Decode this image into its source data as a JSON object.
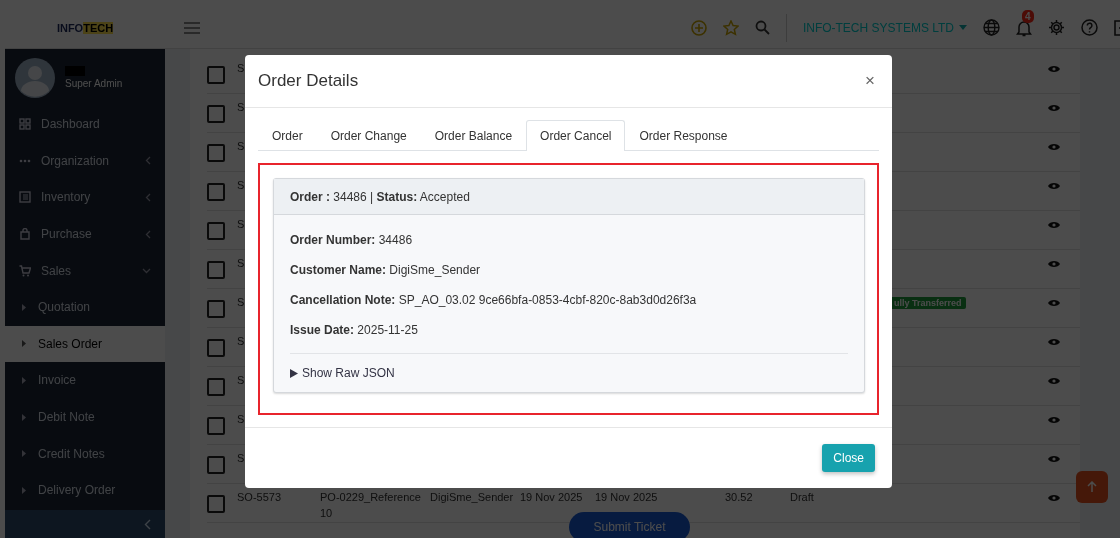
{
  "topbar": {
    "logo": {
      "part_1": "INFO",
      "part_2": "TECH"
    },
    "company": "INFO-TECH SYSTEMS LTD",
    "notification_count": "4"
  },
  "sidebar": {
    "user_role": "Super Admin",
    "items": [
      {
        "label": "Dashboard",
        "kind": "link",
        "selected": false
      },
      {
        "label": "Organization",
        "kind": "group",
        "expanded": false,
        "selected": false
      },
      {
        "label": "Inventory",
        "kind": "group",
        "expanded": false,
        "selected": false
      },
      {
        "label": "Purchase",
        "kind": "group",
        "expanded": false,
        "selected": false
      },
      {
        "label": "Sales",
        "kind": "group",
        "expanded": true,
        "selected": false,
        "children": [
          {
            "label": "Quotation",
            "selected": false
          },
          {
            "label": "Sales Order",
            "selected": true
          },
          {
            "label": "Invoice",
            "selected": false
          },
          {
            "label": "Debit Note",
            "selected": false
          },
          {
            "label": "Credit Notes",
            "selected": false
          },
          {
            "label": "Delivery Order",
            "selected": false
          }
        ]
      }
    ]
  },
  "table": {
    "rows": [
      {
        "checked": false,
        "column_1": "S"
      },
      {
        "checked": false,
        "column_1": "S"
      },
      {
        "checked": false,
        "column_1": "S"
      },
      {
        "checked": false,
        "column_1": "S"
      },
      {
        "checked": false,
        "column_1": "S"
      },
      {
        "checked": false,
        "column_1": "S"
      },
      {
        "checked": false,
        "column_1": "S",
        "badge": "ully Transferred"
      },
      {
        "checked": false,
        "column_1": "S"
      },
      {
        "checked": false,
        "column_1": "S"
      },
      {
        "checked": false,
        "column_1": "S"
      },
      {
        "checked": false,
        "column_1": "S"
      },
      {
        "checked": false,
        "column_1": "SO-5573",
        "column_2": "PO-0229_Reference 10",
        "column_3": "DigiSme_Sender",
        "column_4": "19 Nov 2025",
        "column_5": "19 Nov 2025",
        "column_6": "30.52",
        "column_7": "Draft"
      }
    ]
  },
  "submit_ticket": "Submit Ticket",
  "modal": {
    "title": "Order Details",
    "close_symbol": "×",
    "tabs": [
      {
        "label": "Order",
        "selected": false
      },
      {
        "label": "Order Change",
        "selected": false
      },
      {
        "label": "Order Balance",
        "selected": false
      },
      {
        "label": "Order Cancel",
        "selected": true
      },
      {
        "label": "Order Response",
        "selected": false
      }
    ],
    "highlighted": true,
    "summary": "**Order :** 34486  |  **Status:** Accepted",
    "fields": [
      "**Order Number:** 34486",
      "**Customer Name:** DigiSme_Sender",
      "**Cancellation Note:** SP_AO_03.02 9ce66bfa-0853-4cbf-820c-8ab3d0d26f3a",
      "**Issue Date:** 2025-11-25"
    ],
    "raw_json": {
      "label": "Show Raw JSON",
      "expanded": false
    },
    "close_button": "Close"
  }
}
